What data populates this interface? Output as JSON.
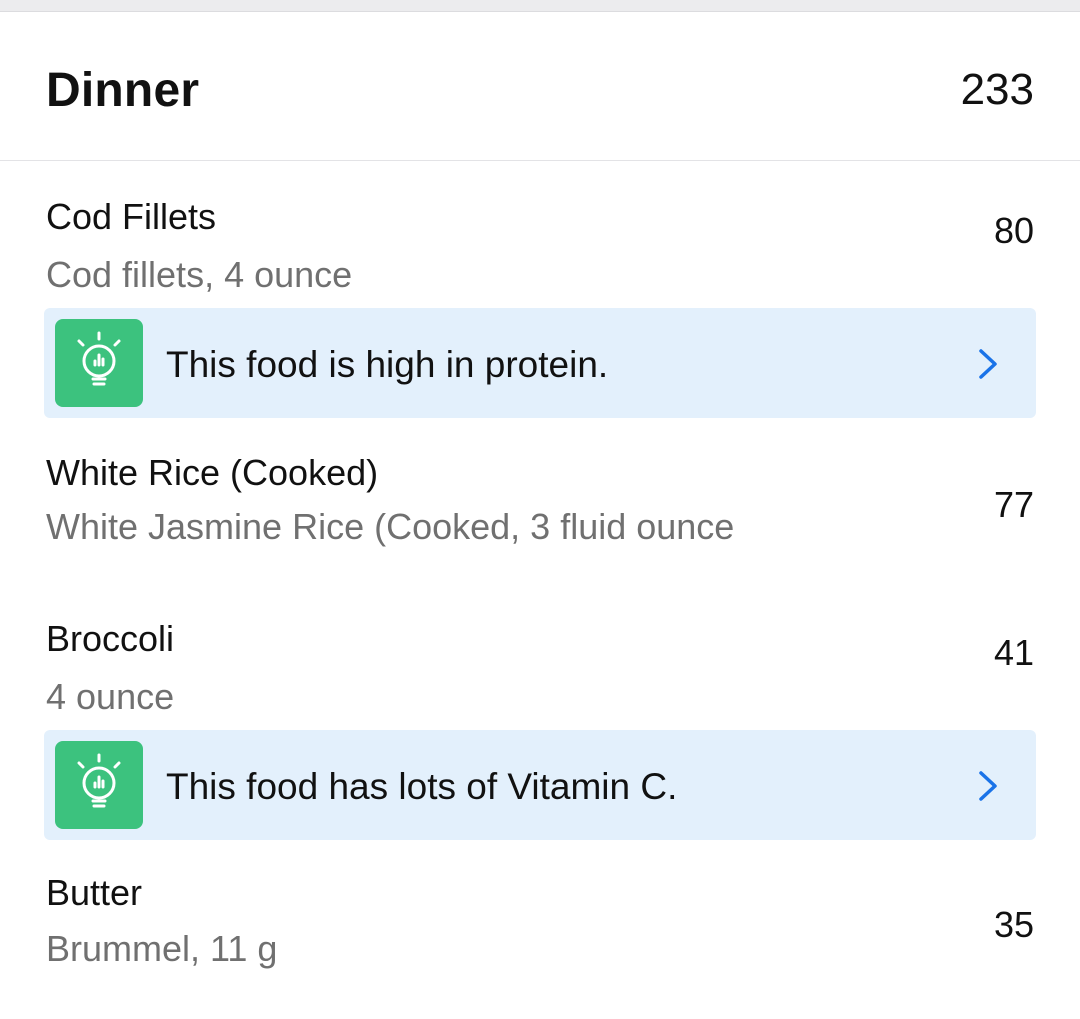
{
  "meal": {
    "title": "Dinner",
    "total_calories": "233"
  },
  "foods": [
    {
      "name": "Cod Fillets",
      "description": "Cod fillets, 4 ounce",
      "calories": "80",
      "tip": {
        "text": "This food is high in protein.",
        "icon": "lightbulb-icon"
      }
    },
    {
      "name": "White Rice (Cooked)",
      "description": "White Jasmine  Rice (Cooked, 3 fluid ounce",
      "calories": "77"
    },
    {
      "name": "Broccoli",
      "description": "4 ounce",
      "calories": "41",
      "tip": {
        "text": "This food has lots of Vitamin C.",
        "icon": "lightbulb-icon"
      }
    },
    {
      "name": "Butter",
      "description": "Brummel, 11 g",
      "calories": "35"
    }
  ],
  "colors": {
    "tip_background": "#e3f0fc",
    "tip_icon": "#3cc27e",
    "chevron": "#1a73e8"
  }
}
